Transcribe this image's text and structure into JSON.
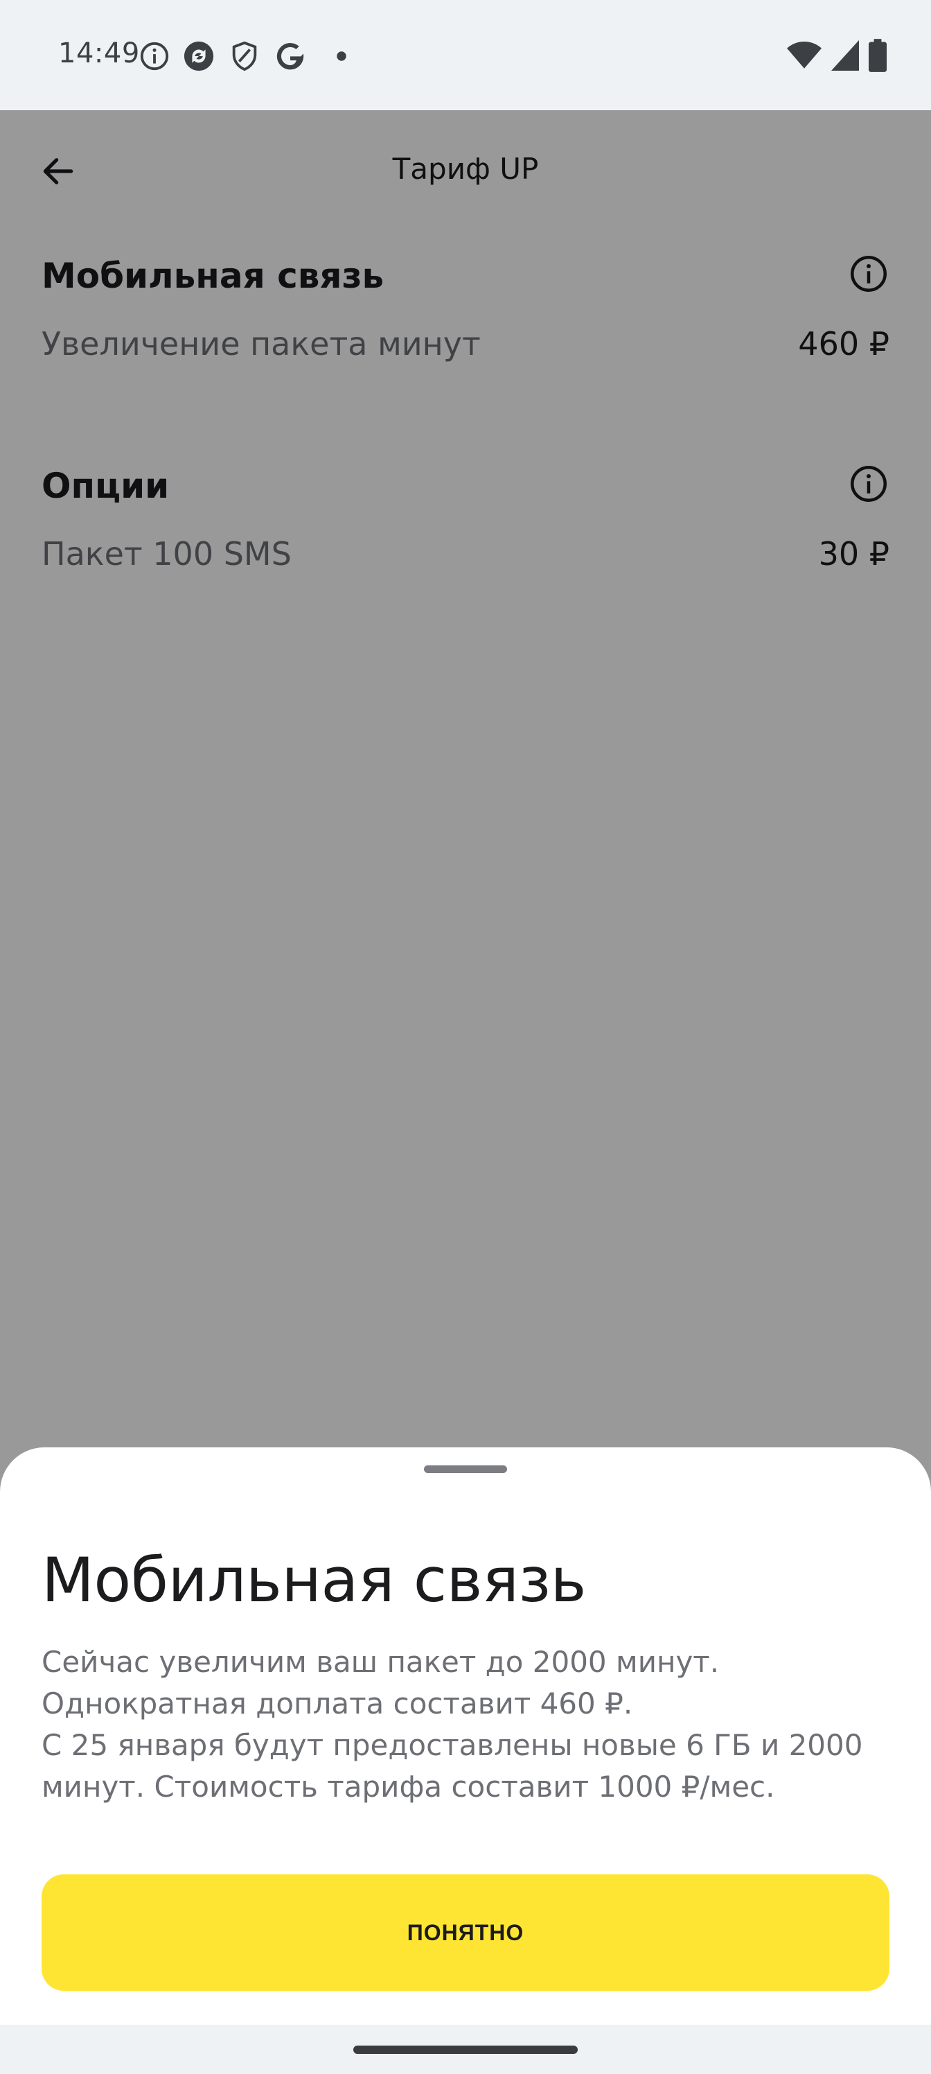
{
  "status_bar": {
    "time": "14:49",
    "left_icons": [
      "info-icon",
      "sync-icon",
      "shield-icon",
      "google-icon",
      "dot-icon"
    ],
    "right_icons": [
      "wifi-icon",
      "signal-icon",
      "battery-icon"
    ]
  },
  "header": {
    "title": "Тариф UP",
    "back_icon": "arrow-left-icon"
  },
  "sections": [
    {
      "title": "Мобильная связь",
      "info_icon": "info-icon",
      "rows": [
        {
          "label": "Увеличение пакета минут",
          "value": "460 ₽"
        }
      ]
    },
    {
      "title": "Опции",
      "info_icon": "info-icon",
      "rows": [
        {
          "label": "Пакет 100 SMS",
          "value": "30 ₽"
        }
      ]
    }
  ],
  "sheet": {
    "title": "Мобильная связь",
    "text": "Сейчас увеличим ваш пакет до 2000 минут. Однократная доплата составит 460 ₽.\nС 25 января будут предоставлены новые 6 ГБ и 2000 минут. Стоимость тарифа составит 1000 ₽/мес.",
    "button_label": "ПОНЯТНО"
  },
  "colors": {
    "accent": "#ffe533",
    "scrim": "rgba(0,0,0,0.40)",
    "text_primary": "#1c1c1e",
    "text_secondary": "#6d6f75"
  }
}
